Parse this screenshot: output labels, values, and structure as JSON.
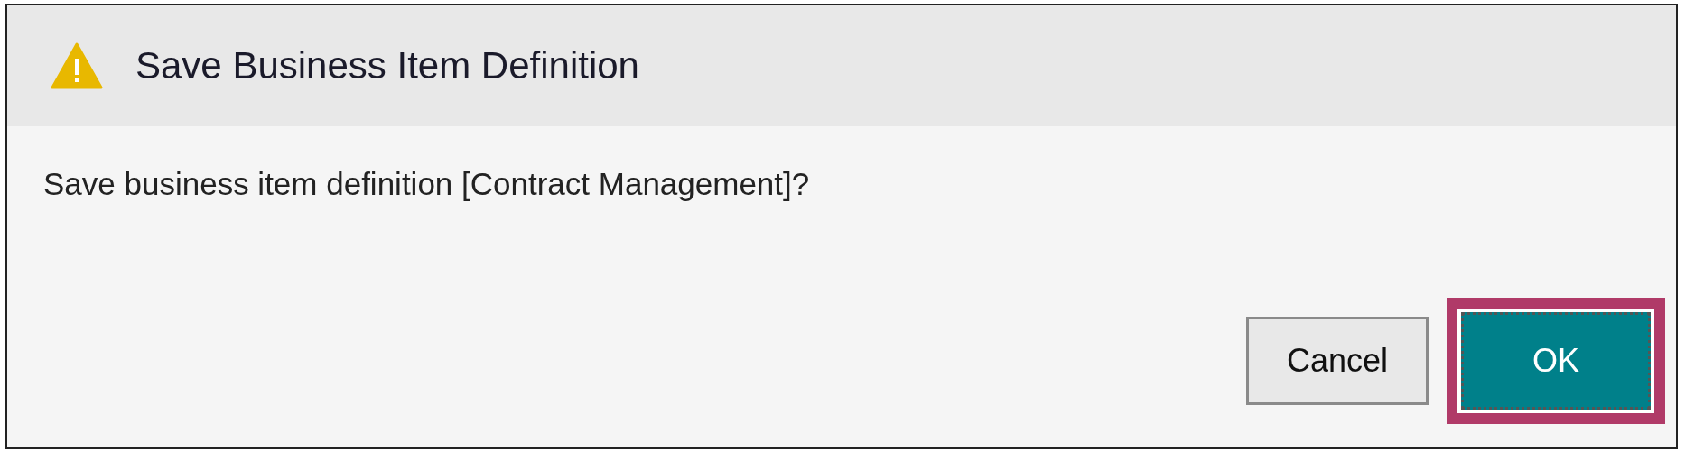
{
  "dialog": {
    "title": "Save Business Item Definition",
    "message": "Save business item definition [Contract Management]?",
    "buttons": [
      {
        "label": "Cancel",
        "kind": "secondary",
        "focused": false
      },
      {
        "label": "OK",
        "kind": "primary",
        "focused": true
      }
    ]
  }
}
